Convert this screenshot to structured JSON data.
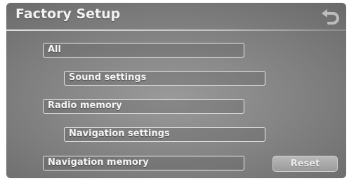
{
  "header": {
    "title": "Factory Setup",
    "back_icon": "u-turn-back-icon"
  },
  "items": [
    {
      "label": "All"
    },
    {
      "label": "Sound settings"
    },
    {
      "label": "Radio memory"
    },
    {
      "label": "Navigation settings"
    },
    {
      "label": "Navigation memory"
    }
  ],
  "actions": {
    "reset_label": "Reset"
  },
  "colors": {
    "background": "#808080",
    "text": "#f5f5f5",
    "button_border": "#ececec"
  }
}
